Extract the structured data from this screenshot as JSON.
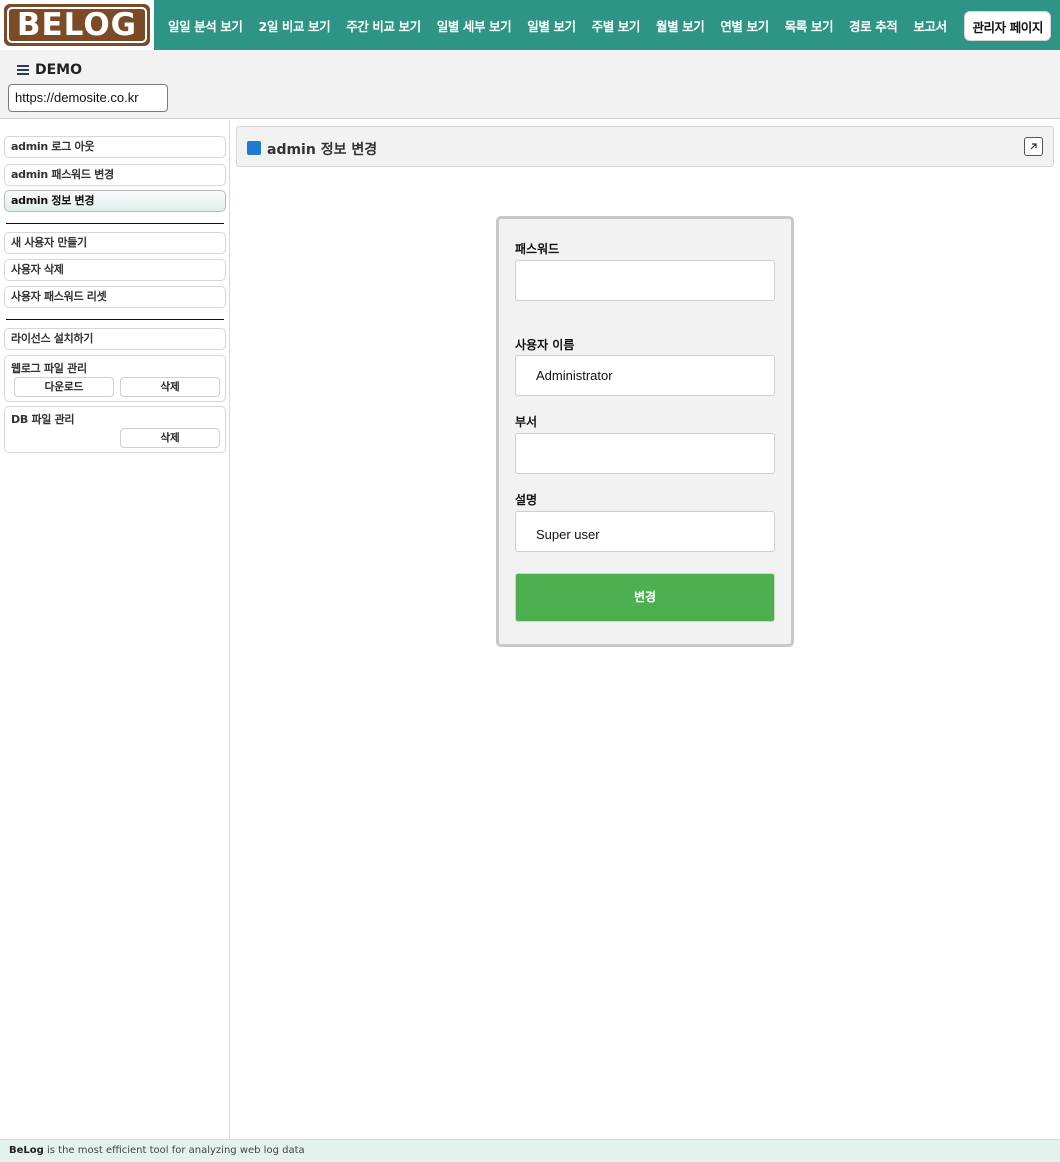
{
  "brand": {
    "logo_text": "BELOG"
  },
  "nav": {
    "items": [
      "일일 분석 보기",
      "2일 비교 보기",
      "주간 비교 보기",
      "일별 세부 보기",
      "일별 보기",
      "주별 보기",
      "월별 보기",
      "연별 보기",
      "목록 보기",
      "경로 추적",
      "보고서"
    ],
    "admin_label": "관리자 페이지"
  },
  "site": {
    "name": "DEMO",
    "url": "https://demosite.co.kr"
  },
  "sidebar": {
    "group1": [
      "admin 로그 아웃",
      "admin 패스워드 변경",
      "admin 정보 변경"
    ],
    "active": "admin 정보 변경",
    "group2": [
      "새 사용자 만들기",
      "사용자 삭제",
      "사용자 패스워드 리셋"
    ],
    "license": "라이선스 설치하기",
    "weblog": {
      "title": "웹로그 파일 관리",
      "download": "다운로드",
      "delete": "삭제"
    },
    "db": {
      "title": "DB 파일 관리",
      "delete": "삭제"
    }
  },
  "panel": {
    "title": "admin 정보 변경"
  },
  "form": {
    "password_label": "패스워드",
    "password_value": "",
    "username_label": "사용자 이름",
    "username_value": "Administrator",
    "dept_label": "부서",
    "dept_value": "",
    "desc_label": "설명",
    "desc_value": "Super user",
    "submit_label": "변경"
  },
  "footer": {
    "brand": "BeLog",
    "text": " is the most efficient tool for analyzing web log data"
  },
  "colors": {
    "nav_bg": "#2e9486",
    "logo_bg": "#7b4a26",
    "submit_bg": "#4caf50",
    "title_square": "#1f7ad1"
  }
}
